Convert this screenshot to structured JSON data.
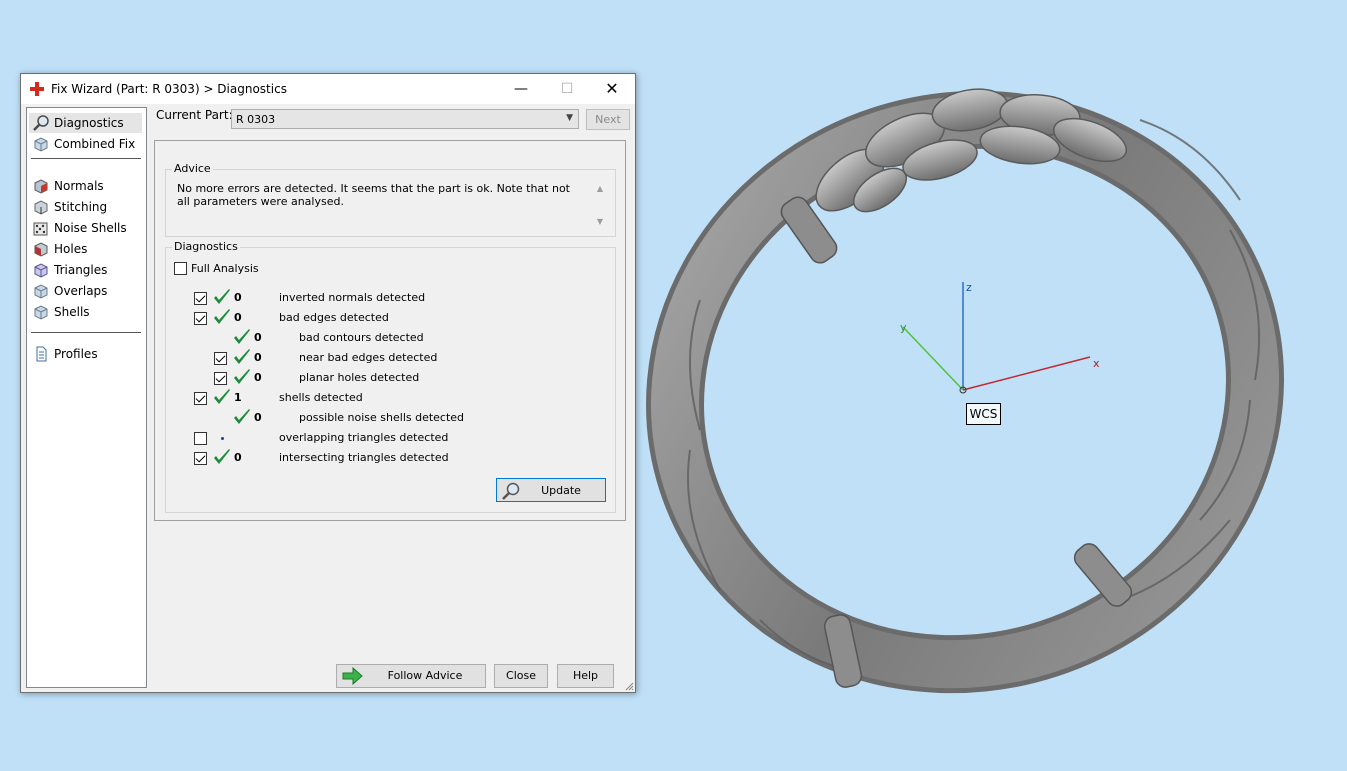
{
  "window": {
    "title": "Fix Wizard (Part: R 0303) > Diagnostics",
    "minimize_glyph": "—",
    "maximize_glyph": "☐",
    "close_glyph": "✕"
  },
  "nav": {
    "items": [
      {
        "label": "Diagnostics",
        "icon": "magnifier-icon",
        "selected": true
      },
      {
        "label": "Combined Fix",
        "icon": "cube-icon"
      },
      {
        "label": "Normals",
        "icon": "normals-cube-icon"
      },
      {
        "label": "Stitching",
        "icon": "stitching-cube-icon"
      },
      {
        "label": "Noise Shells",
        "icon": "noise-shells-icon"
      },
      {
        "label": "Holes",
        "icon": "holes-cube-icon"
      },
      {
        "label": "Triangles",
        "icon": "triangles-cube-icon"
      },
      {
        "label": "Overlaps",
        "icon": "overlaps-cube-icon"
      },
      {
        "label": "Shells",
        "icon": "shells-cube-icon"
      },
      {
        "label": "Profiles",
        "icon": "document-icon"
      }
    ]
  },
  "current_part": {
    "label": "Current Part:",
    "value": "R 0303",
    "next_label": "Next"
  },
  "advice": {
    "title": "Advice",
    "text": "No more errors are detected. It seems that the part is ok. Note that not all parameters were analysed."
  },
  "diagnostics": {
    "title": "Diagnostics",
    "full_analysis_label": "Full Analysis",
    "rows": [
      {
        "checked": true,
        "status": "ok",
        "count": "0",
        "label": "inverted normals detected",
        "indent": 0
      },
      {
        "checked": true,
        "status": "ok",
        "count": "0",
        "label": "bad edges detected",
        "indent": 0
      },
      {
        "checked": null,
        "status": "ok",
        "count": "0",
        "label": "bad contours detected",
        "indent": 1
      },
      {
        "checked": true,
        "status": "ok",
        "count": "0",
        "label": "near bad edges detected",
        "indent": 1
      },
      {
        "checked": true,
        "status": "ok",
        "count": "0",
        "label": "planar holes detected",
        "indent": 1
      },
      {
        "checked": true,
        "status": "ok",
        "count": "1",
        "label": "shells detected",
        "indent": 0
      },
      {
        "checked": null,
        "status": "ok",
        "count": "0",
        "label": "possible noise shells detected",
        "indent": 1
      },
      {
        "checked": false,
        "status": "unknown",
        "count": "",
        "label": "overlapping triangles detected",
        "indent": 0
      },
      {
        "checked": true,
        "status": "ok",
        "count": "0",
        "label": "intersecting triangles detected",
        "indent": 0
      }
    ],
    "update_label": "Update"
  },
  "buttons": {
    "follow_advice": "Follow Advice",
    "close": "Close",
    "help": "Help"
  },
  "viewport": {
    "axis_x": "x",
    "axis_y": "y",
    "axis_z": "z",
    "wcs_label": "WCS"
  },
  "colors": {
    "background": "#bfe0f7",
    "check_green": "#1f8a3b",
    "axis_x": "#c0292f",
    "axis_y": "#52c23a",
    "axis_z": "#2a6fd1",
    "ring": "#8a8a8a"
  }
}
